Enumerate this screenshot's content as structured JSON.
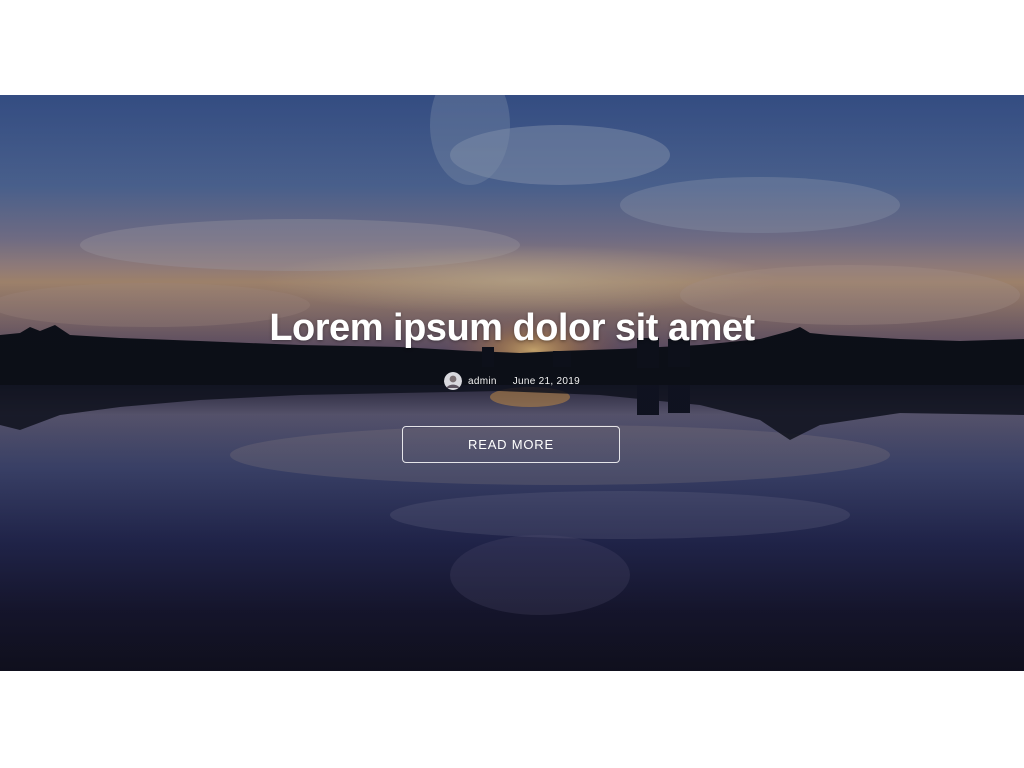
{
  "hero": {
    "title": "Lorem ipsum dolor sit amet",
    "author": "admin",
    "date": "June 21, 2019",
    "button_label": "READ MORE",
    "background": "sunset-lake-reflection"
  },
  "colors": {
    "page_background": "#ffffff",
    "sky_top": "#4a6aa8",
    "horizon_glow": "#c9a78a",
    "water_dark": "#1a1a30",
    "text": "#ffffff"
  },
  "icons": {
    "avatar": "author-avatar"
  }
}
